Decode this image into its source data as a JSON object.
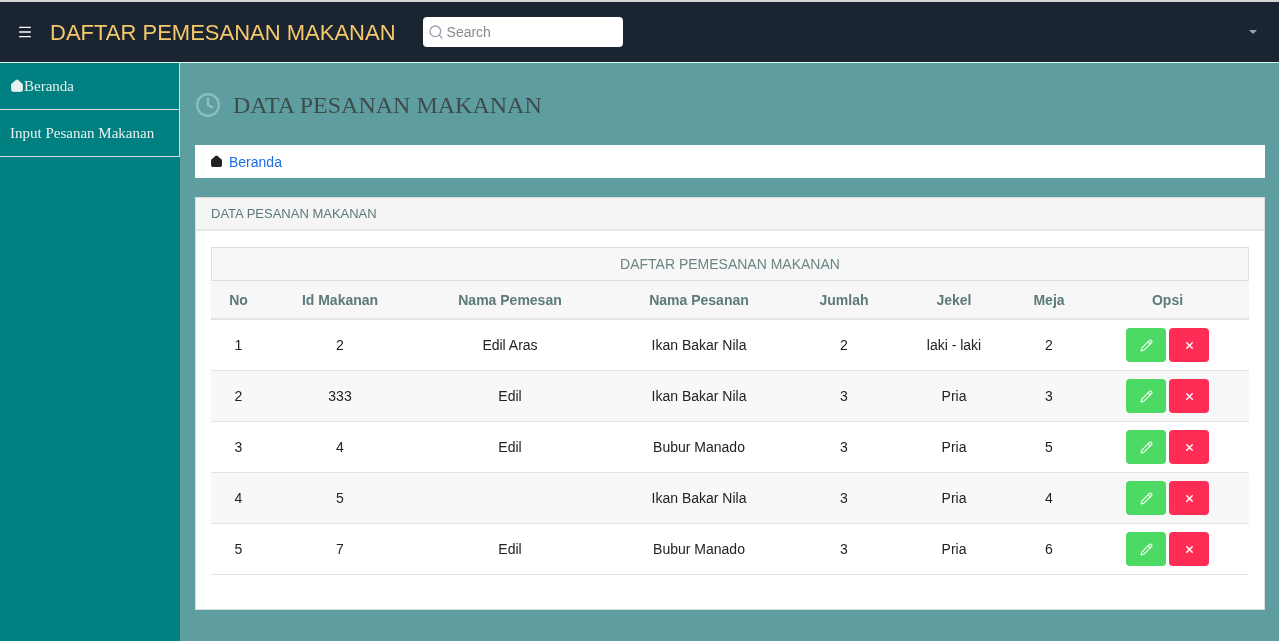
{
  "header": {
    "title": "DAFTAR PEMESANAN MAKANAN",
    "search": {
      "placeholder": "Search"
    }
  },
  "sidebar": {
    "items": [
      {
        "label": "Beranda",
        "kind": "home"
      },
      {
        "label": "Input Pesanan Makanan",
        "kind": "plain"
      }
    ]
  },
  "page_title": "DATA PESANAN MAKANAN",
  "breadcrumb": {
    "label": "Beranda"
  },
  "panel": {
    "title": "DATA PESANAN MAKANAN",
    "table": {
      "caption": "DAFTAR PEMESANAN MAKANAN",
      "columns": [
        "No",
        "Id Makanan",
        "Nama Pemesan",
        "Nama Pesanan",
        "Jumlah",
        "Jekel",
        "Meja",
        "Opsi"
      ],
      "rows": [
        {
          "cells": [
            "1",
            "2",
            "Edil Aras",
            "Ikan Bakar Nila",
            "2",
            "laki - laki",
            "2"
          ]
        },
        {
          "cells": [
            "2",
            "333",
            "Edil",
            "Ikan Bakar Nila",
            "3",
            "Pria",
            "3"
          ]
        },
        {
          "cells": [
            "3",
            "4",
            "Edil",
            "Bubur Manado",
            "3",
            "Pria",
            "5"
          ]
        },
        {
          "cells": [
            "4",
            "5",
            "",
            "Ikan Bakar Nila",
            "3",
            "Pria",
            "4"
          ]
        },
        {
          "cells": [
            "5",
            "7",
            "Edil",
            "Bubur Manado",
            "3",
            "Pria",
            "6"
          ]
        }
      ]
    }
  }
}
